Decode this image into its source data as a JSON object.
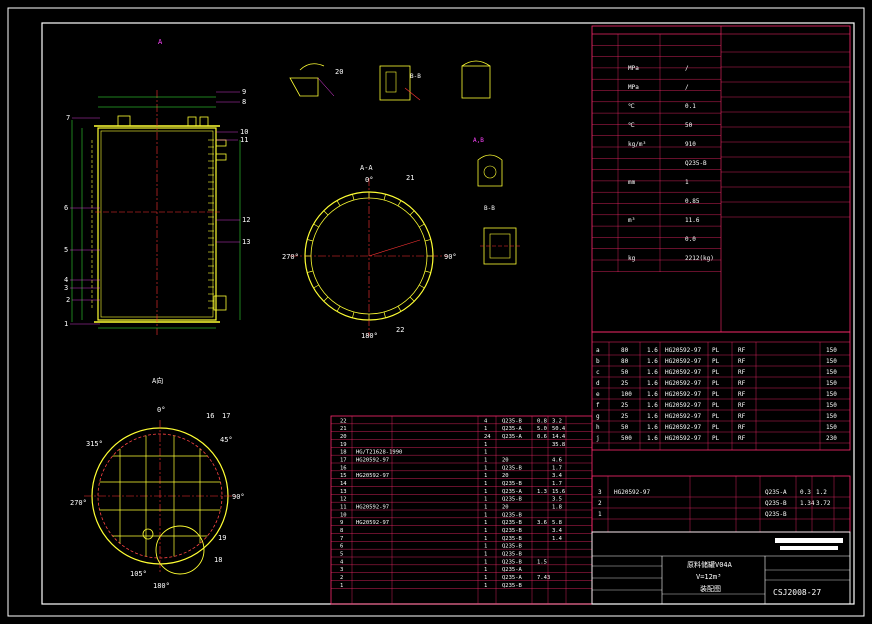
{
  "colors": {
    "background": "#000000",
    "border": "#ffffff",
    "table": "#ff2a6d",
    "dimension": "#3cff3c",
    "geometry": "#ffff33",
    "text": "#ffffff",
    "leader": "#ff44ff",
    "centerline": "#ff3333"
  },
  "views": {
    "main": {
      "top_label": "A",
      "labels": [
        "1",
        "2",
        "3",
        "4",
        "5",
        "6",
        "7",
        "8",
        "9",
        "10",
        "11",
        "12",
        "13"
      ]
    },
    "section_aa": {
      "title": "A-A",
      "angles": [
        "0°",
        "90°",
        "180°",
        "270°"
      ],
      "labels": [
        "21",
        "22"
      ]
    },
    "plan": {
      "title": "A向",
      "angles": [
        "0°",
        "45°",
        "90°",
        "105°",
        "180°",
        "270°",
        "315°"
      ],
      "labels": [
        "16",
        "17",
        "18",
        "19"
      ]
    },
    "details": [
      {
        "title": "B-B"
      },
      {
        "title": "A,B"
      },
      {
        "title": "B-B"
      }
    ],
    "detail_labels": [
      "20",
      "21",
      "8"
    ]
  },
  "title_block": {
    "equipment_name": "原料储罐V04A",
    "volume": "V=12m³",
    "drawing_type": "装配图",
    "drawing_no": "CSJ2008-27"
  },
  "design_data": {
    "values": [
      "/",
      "/",
      "0.1",
      "50",
      "910",
      "Q235-B",
      "1",
      "0.85",
      "11.6",
      "0.0",
      "2212(kg)"
    ],
    "units": [
      "MPa",
      "MPa",
      "℃",
      "℃",
      "kg/m³",
      "",
      "mm",
      "",
      "m³",
      "",
      "kg"
    ]
  },
  "nozzles": {
    "rows": [
      {
        "mark": "a",
        "dn": "80",
        "pn": "1.6",
        "std": "HG20592-97",
        "type": "PL",
        "face": "RF",
        "len": "150"
      },
      {
        "mark": "b",
        "dn": "80",
        "pn": "1.6",
        "std": "HG20592-97",
        "type": "PL",
        "face": "RF",
        "len": "150"
      },
      {
        "mark": "c",
        "dn": "50",
        "pn": "1.6",
        "std": "HG20592-97",
        "type": "PL",
        "face": "RF",
        "len": "150"
      },
      {
        "mark": "d",
        "dn": "25",
        "pn": "1.6",
        "std": "HG20592-97",
        "type": "PL",
        "face": "RF",
        "len": "150"
      },
      {
        "mark": "e",
        "dn": "100",
        "pn": "1.6",
        "std": "HG20592-97",
        "type": "PL",
        "face": "RF",
        "len": "150"
      },
      {
        "mark": "f",
        "dn": "25",
        "pn": "1.6",
        "std": "HG20592-97",
        "type": "PL",
        "face": "RF",
        "len": "150"
      },
      {
        "mark": "g",
        "dn": "25",
        "pn": "1.6",
        "std": "HG20592-97",
        "type": "PL",
        "face": "RF",
        "len": "150"
      },
      {
        "mark": "h",
        "dn": "50",
        "pn": "1.6",
        "std": "HG20592-97",
        "type": "PL",
        "face": "RF",
        "len": "150"
      },
      {
        "mark": "j",
        "dn": "500",
        "pn": "1.6",
        "std": "HG20592-97",
        "type": "PL",
        "face": "RF",
        "len": "230"
      }
    ]
  },
  "parts_list": {
    "rows": [
      {
        "no": "22",
        "std": "",
        "qty": "4",
        "mat": "Q235-B",
        "w1": "0.8",
        "w2": "3.2"
      },
      {
        "no": "21",
        "std": "",
        "qty": "1",
        "mat": "Q235-A",
        "w1": "5.0",
        "w2": "50.4"
      },
      {
        "no": "20",
        "std": "",
        "qty": "24",
        "mat": "Q235-A",
        "w1": "0.6",
        "w2": "14.4"
      },
      {
        "no": "19",
        "std": "",
        "qty": "1",
        "mat": "",
        "w1": "",
        "w2": "35.8"
      },
      {
        "no": "18",
        "std": "HG/T21628-1990",
        "qty": "1",
        "mat": "",
        "w1": "",
        "w2": ""
      },
      {
        "no": "17",
        "std": "HG20592-97",
        "qty": "1",
        "mat": "20",
        "w1": "",
        "w2": "4.6"
      },
      {
        "no": "16",
        "std": "",
        "qty": "1",
        "mat": "Q235-B",
        "w1": "",
        "w2": "1.7"
      },
      {
        "no": "15",
        "std": "HG20592-97",
        "qty": "1",
        "mat": "20",
        "w1": "",
        "w2": "3.4"
      },
      {
        "no": "14",
        "std": "",
        "qty": "1",
        "mat": "Q235-B",
        "w1": "",
        "w2": "1.7"
      },
      {
        "no": "13",
        "std": "",
        "qty": "1",
        "mat": "Q235-A",
        "w1": "1.3",
        "w2": "15.6"
      },
      {
        "no": "12",
        "std": "",
        "qty": "1",
        "mat": "Q235-B",
        "w1": "",
        "w2": "3.5"
      },
      {
        "no": "11",
        "std": "HG20592-97",
        "qty": "1",
        "mat": "20",
        "w1": "",
        "w2": "1.8"
      },
      {
        "no": "10",
        "std": "",
        "qty": "1",
        "mat": "Q235-B",
        "w1": "",
        "w2": ""
      },
      {
        "no": "9",
        "std": "HG20592-97",
        "qty": "1",
        "mat": "Q235-B",
        "w1": "3.6",
        "w2": "5.8"
      },
      {
        "no": "8",
        "std": "",
        "qty": "1",
        "mat": "Q235-B",
        "w1": "",
        "w2": "3.4"
      },
      {
        "no": "7",
        "std": "",
        "qty": "1",
        "mat": "Q235-B",
        "w1": "",
        "w2": "1.4"
      },
      {
        "no": "6",
        "std": "",
        "qty": "1",
        "mat": "Q235-B",
        "w1": "",
        "w2": ""
      },
      {
        "no": "5",
        "std": "",
        "qty": "1",
        "mat": "Q235-B",
        "w1": "",
        "w2": ""
      },
      {
        "no": "4",
        "std": "",
        "qty": "1",
        "mat": "Q235-B",
        "w1": "1.5",
        "w2": ""
      },
      {
        "no": "3",
        "std": "",
        "qty": "1",
        "mat": "Q235-A",
        "w1": "",
        "w2": ""
      },
      {
        "no": "2",
        "std": "",
        "qty": "1",
        "mat": "Q235-A",
        "w1": "7.43",
        "w2": ""
      },
      {
        "no": "1",
        "std": "",
        "qty": "1",
        "mat": "Q235-B",
        "w1": "",
        "w2": ""
      }
    ]
  },
  "mini_parts": {
    "rows": [
      {
        "no": "3",
        "std": "HG20592-97",
        "mat": "Q235-A",
        "w1": "0.3",
        "w2": "1.2"
      },
      {
        "no": "2",
        "std": "",
        "mat": "Q235-B",
        "w1": "1.34",
        "w2": "3.72"
      },
      {
        "no": "1",
        "std": "",
        "mat": "Q235-B",
        "w1": "",
        "w2": ""
      }
    ]
  }
}
